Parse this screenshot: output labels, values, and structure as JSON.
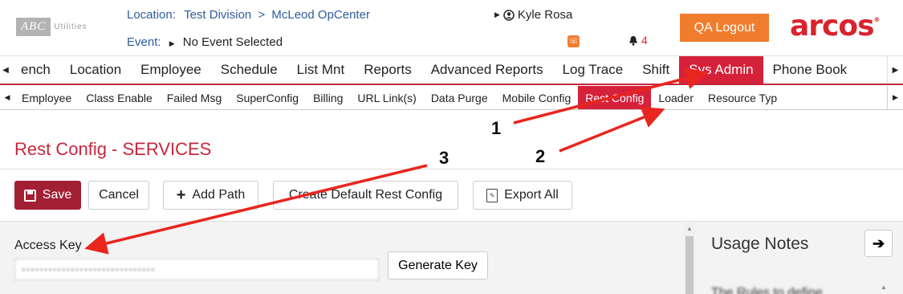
{
  "header": {
    "logo": {
      "main": "ABC",
      "sub": "Utilities"
    },
    "location_label": "Location:",
    "location_division": "Test Division",
    "location_separator": ">",
    "location_center": "McLeod OpCenter",
    "event_label": "Event:",
    "event_value": "No Event Selected",
    "user_name": "Kyle Rosa",
    "notification_count": "4",
    "logout_label": "QA  Logout",
    "brand": "arcos",
    "brand_mark": "®"
  },
  "main_nav": {
    "items": [
      {
        "label": "ench"
      },
      {
        "label": "Location"
      },
      {
        "label": "Employee"
      },
      {
        "label": "Schedule"
      },
      {
        "label": "List Mnt"
      },
      {
        "label": "Reports"
      },
      {
        "label": "Advanced Reports"
      },
      {
        "label": "Log Trace"
      },
      {
        "label": "Shift"
      },
      {
        "label": "Sys Admin",
        "active": true
      },
      {
        "label": "Phone Book"
      }
    ]
  },
  "sub_nav": {
    "items": [
      {
        "label": "Employee"
      },
      {
        "label": "Class Enable"
      },
      {
        "label": "Failed Msg"
      },
      {
        "label": "SuperConfig"
      },
      {
        "label": "Billing"
      },
      {
        "label": "URL Link(s)"
      },
      {
        "label": "Data Purge"
      },
      {
        "label": "Mobile Config"
      },
      {
        "label": "Rest Config",
        "active": true
      },
      {
        "label": "Loader"
      },
      {
        "label": "Resource Typ"
      }
    ]
  },
  "page": {
    "title": "Rest Config - SERVICES"
  },
  "toolbar": {
    "save_label": "Save",
    "cancel_label": "Cancel",
    "add_path_label": "Add Path",
    "create_default_label": "Create Default Rest Config",
    "export_all_label": "Export All"
  },
  "form": {
    "access_key_label": "Access Key",
    "access_key_value": "••••••••••••••••••••••••••••••",
    "generate_key_label": "Generate Key"
  },
  "usage_notes": {
    "title": "Usage Notes",
    "text": "The Rules to define"
  },
  "annotations": {
    "labels": [
      "1",
      "2",
      "3"
    ],
    "color": "#e8261f"
  },
  "colors": {
    "accent": "#d6213a",
    "save": "#a31f34",
    "orange": "#f07d2e",
    "link": "#2f5d9c"
  }
}
